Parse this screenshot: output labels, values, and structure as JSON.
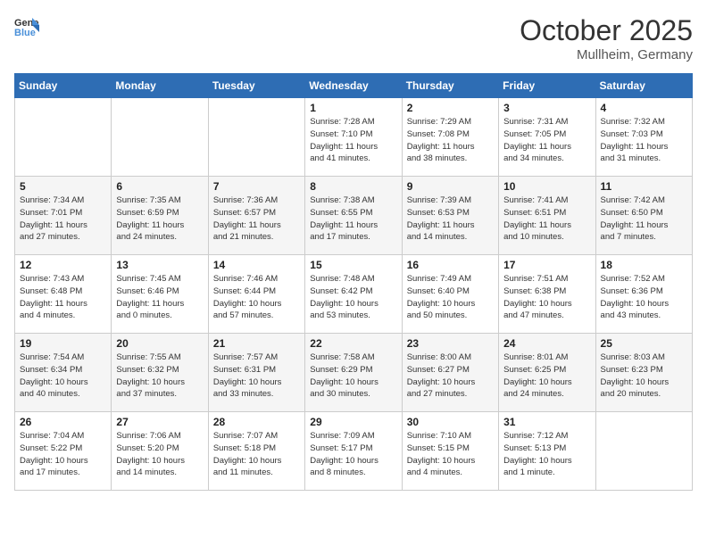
{
  "header": {
    "logo_general": "General",
    "logo_blue": "Blue",
    "month": "October 2025",
    "location": "Mullheim, Germany"
  },
  "days_of_week": [
    "Sunday",
    "Monday",
    "Tuesday",
    "Wednesday",
    "Thursday",
    "Friday",
    "Saturday"
  ],
  "weeks": [
    [
      {
        "num": "",
        "info": ""
      },
      {
        "num": "",
        "info": ""
      },
      {
        "num": "",
        "info": ""
      },
      {
        "num": "1",
        "info": "Sunrise: 7:28 AM\nSunset: 7:10 PM\nDaylight: 11 hours\nand 41 minutes."
      },
      {
        "num": "2",
        "info": "Sunrise: 7:29 AM\nSunset: 7:08 PM\nDaylight: 11 hours\nand 38 minutes."
      },
      {
        "num": "3",
        "info": "Sunrise: 7:31 AM\nSunset: 7:05 PM\nDaylight: 11 hours\nand 34 minutes."
      },
      {
        "num": "4",
        "info": "Sunrise: 7:32 AM\nSunset: 7:03 PM\nDaylight: 11 hours\nand 31 minutes."
      }
    ],
    [
      {
        "num": "5",
        "info": "Sunrise: 7:34 AM\nSunset: 7:01 PM\nDaylight: 11 hours\nand 27 minutes."
      },
      {
        "num": "6",
        "info": "Sunrise: 7:35 AM\nSunset: 6:59 PM\nDaylight: 11 hours\nand 24 minutes."
      },
      {
        "num": "7",
        "info": "Sunrise: 7:36 AM\nSunset: 6:57 PM\nDaylight: 11 hours\nand 21 minutes."
      },
      {
        "num": "8",
        "info": "Sunrise: 7:38 AM\nSunset: 6:55 PM\nDaylight: 11 hours\nand 17 minutes."
      },
      {
        "num": "9",
        "info": "Sunrise: 7:39 AM\nSunset: 6:53 PM\nDaylight: 11 hours\nand 14 minutes."
      },
      {
        "num": "10",
        "info": "Sunrise: 7:41 AM\nSunset: 6:51 PM\nDaylight: 11 hours\nand 10 minutes."
      },
      {
        "num": "11",
        "info": "Sunrise: 7:42 AM\nSunset: 6:50 PM\nDaylight: 11 hours\nand 7 minutes."
      }
    ],
    [
      {
        "num": "12",
        "info": "Sunrise: 7:43 AM\nSunset: 6:48 PM\nDaylight: 11 hours\nand 4 minutes."
      },
      {
        "num": "13",
        "info": "Sunrise: 7:45 AM\nSunset: 6:46 PM\nDaylight: 11 hours\nand 0 minutes."
      },
      {
        "num": "14",
        "info": "Sunrise: 7:46 AM\nSunset: 6:44 PM\nDaylight: 10 hours\nand 57 minutes."
      },
      {
        "num": "15",
        "info": "Sunrise: 7:48 AM\nSunset: 6:42 PM\nDaylight: 10 hours\nand 53 minutes."
      },
      {
        "num": "16",
        "info": "Sunrise: 7:49 AM\nSunset: 6:40 PM\nDaylight: 10 hours\nand 50 minutes."
      },
      {
        "num": "17",
        "info": "Sunrise: 7:51 AM\nSunset: 6:38 PM\nDaylight: 10 hours\nand 47 minutes."
      },
      {
        "num": "18",
        "info": "Sunrise: 7:52 AM\nSunset: 6:36 PM\nDaylight: 10 hours\nand 43 minutes."
      }
    ],
    [
      {
        "num": "19",
        "info": "Sunrise: 7:54 AM\nSunset: 6:34 PM\nDaylight: 10 hours\nand 40 minutes."
      },
      {
        "num": "20",
        "info": "Sunrise: 7:55 AM\nSunset: 6:32 PM\nDaylight: 10 hours\nand 37 minutes."
      },
      {
        "num": "21",
        "info": "Sunrise: 7:57 AM\nSunset: 6:31 PM\nDaylight: 10 hours\nand 33 minutes."
      },
      {
        "num": "22",
        "info": "Sunrise: 7:58 AM\nSunset: 6:29 PM\nDaylight: 10 hours\nand 30 minutes."
      },
      {
        "num": "23",
        "info": "Sunrise: 8:00 AM\nSunset: 6:27 PM\nDaylight: 10 hours\nand 27 minutes."
      },
      {
        "num": "24",
        "info": "Sunrise: 8:01 AM\nSunset: 6:25 PM\nDaylight: 10 hours\nand 24 minutes."
      },
      {
        "num": "25",
        "info": "Sunrise: 8:03 AM\nSunset: 6:23 PM\nDaylight: 10 hours\nand 20 minutes."
      }
    ],
    [
      {
        "num": "26",
        "info": "Sunrise: 7:04 AM\nSunset: 5:22 PM\nDaylight: 10 hours\nand 17 minutes."
      },
      {
        "num": "27",
        "info": "Sunrise: 7:06 AM\nSunset: 5:20 PM\nDaylight: 10 hours\nand 14 minutes."
      },
      {
        "num": "28",
        "info": "Sunrise: 7:07 AM\nSunset: 5:18 PM\nDaylight: 10 hours\nand 11 minutes."
      },
      {
        "num": "29",
        "info": "Sunrise: 7:09 AM\nSunset: 5:17 PM\nDaylight: 10 hours\nand 8 minutes."
      },
      {
        "num": "30",
        "info": "Sunrise: 7:10 AM\nSunset: 5:15 PM\nDaylight: 10 hours\nand 4 minutes."
      },
      {
        "num": "31",
        "info": "Sunrise: 7:12 AM\nSunset: 5:13 PM\nDaylight: 10 hours\nand 1 minute."
      },
      {
        "num": "",
        "info": ""
      }
    ]
  ]
}
